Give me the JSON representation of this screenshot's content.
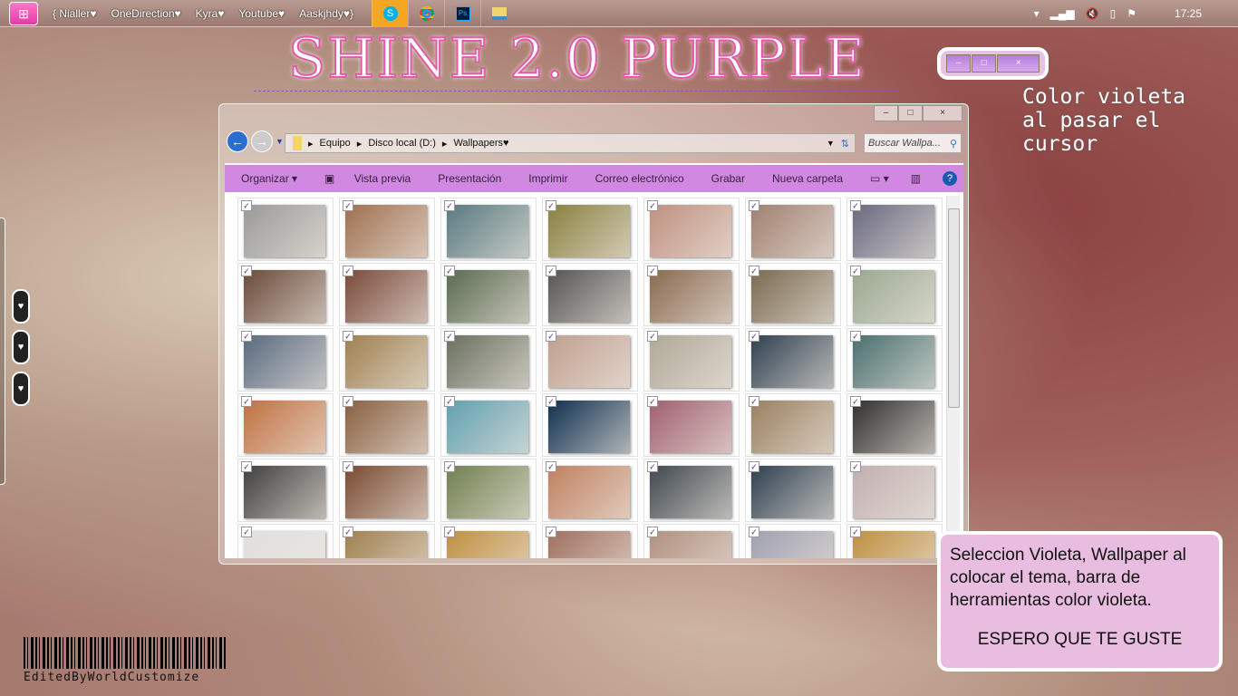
{
  "taskbar": {
    "links": [
      "{ Nialler♥",
      "OneDirection♥",
      "Kyra♥",
      "Youtube♥",
      "Aaskjhdy♥}"
    ],
    "apps": [
      "Skype",
      "Chrome",
      "Photoshop",
      "Explorer"
    ],
    "clock": "17:25"
  },
  "title": "SHINE 2.0 PURPLE",
  "hover_note": {
    "lines": [
      "Color violeta",
      "al pasar el",
      "cursor"
    ]
  },
  "demo_buttons": {
    "minimize": "–",
    "maximize": "□",
    "close": "×"
  },
  "explorer": {
    "controls": {
      "minimize": "–",
      "maximize": "□",
      "close": "×"
    },
    "breadcrumb": [
      "Equipo",
      "Disco local (D:)",
      "Wallpapers♥"
    ],
    "search_placeholder": "Buscar Wallpa...",
    "toolbar": [
      "Organizar ▾",
      "Vista previa",
      "Presentación",
      "Imprimir",
      "Correo electrónico",
      "Grabar",
      "Nueva carpeta"
    ],
    "thumb_colors": [
      "#9a9a9a",
      "#a07050",
      "#5a7a80",
      "#8a8040",
      "#c09080",
      "#a08070",
      "#6a6a80",
      "#6a4a3a",
      "#7a4a3a",
      "#5a6a50",
      "#555",
      "#8a6a50",
      "#7a6a50",
      "#9aa890",
      "#5a6a80",
      "#a08050",
      "#6a7060",
      "#c0a090",
      "#b0a898",
      "#304050",
      "#4a7070",
      "#c07040",
      "#8a6040",
      "#60a0b0",
      "#103050",
      "#a06070",
      "#9a8060",
      "#303030",
      "#404040",
      "#7a4a30",
      "#708050",
      "#c08060",
      "#404850",
      "#304050",
      "#c0b0b0",
      "#e0e0e0",
      "#a08050",
      "#c09040",
      "#a07060",
      "#b09080",
      "#a0a0b0",
      "#c09040"
    ],
    "checkmark": "✓"
  },
  "gadget": {
    "heart": "♥"
  },
  "info_note": {
    "text": "Seleccion Violeta, Wallpaper al colocar el tema, barra de herramientas color violeta.",
    "closing": "ESPERO QUE TE GUSTE"
  },
  "credit": "EditedByWorldCustomize"
}
